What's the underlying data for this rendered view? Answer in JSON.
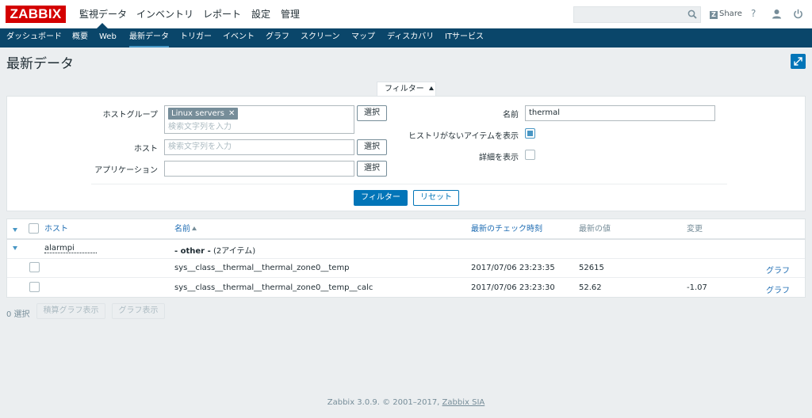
{
  "logo": "ZABBIX",
  "main_menu": [
    "監視データ",
    "インベントリ",
    "レポート",
    "設定",
    "管理"
  ],
  "header": {
    "share": "Share",
    "help": "?"
  },
  "sub_menu": [
    "ダッシュボード",
    "概要",
    "Web",
    "最新データ",
    "トリガー",
    "イベント",
    "グラフ",
    "スクリーン",
    "マップ",
    "ディスカバリ",
    "ITサービス"
  ],
  "page_title": "最新データ",
  "filter": {
    "tab_label": "フィルター",
    "host_group_label": "ホストグループ",
    "host_group_chip": "Linux servers",
    "search_placeholder": "検索文字列を入力",
    "host_label": "ホスト",
    "application_label": "アプリケーション",
    "select_label": "選択",
    "name_label": "名前",
    "name_value": "thermal",
    "no_history_label": "ヒストリがないアイテムを表示",
    "no_history_checked": true,
    "details_label": "詳細を表示",
    "details_checked": false,
    "apply_label": "フィルター",
    "reset_label": "リセット"
  },
  "table": {
    "headers": {
      "host": "ホスト",
      "name": "名前",
      "last_check": "最新のチェック時刻",
      "last_value": "最新の値",
      "change": "変更"
    },
    "group_host": "alarmpi",
    "group_title": "- other -",
    "group_count": "(2アイテム)",
    "rows": [
      {
        "name": "sys__class__thermal__thermal_zone0__temp",
        "last_check": "2017/07/06 23:23:35",
        "last_value": "52615",
        "change": "",
        "link": "グラフ"
      },
      {
        "name": "sys__class__thermal__thermal_zone0__temp__calc",
        "last_check": "2017/07/06 23:23:30",
        "last_value": "52.62",
        "change": "-1.07",
        "link": "グラフ"
      }
    ]
  },
  "actions": {
    "selected_count": "0 選択",
    "stacked_graph": "積算グラフ表示",
    "graph": "グラフ表示"
  },
  "footer": {
    "text": "Zabbix 3.0.9. © 2001–2017,",
    "company": "Zabbix SIA"
  }
}
